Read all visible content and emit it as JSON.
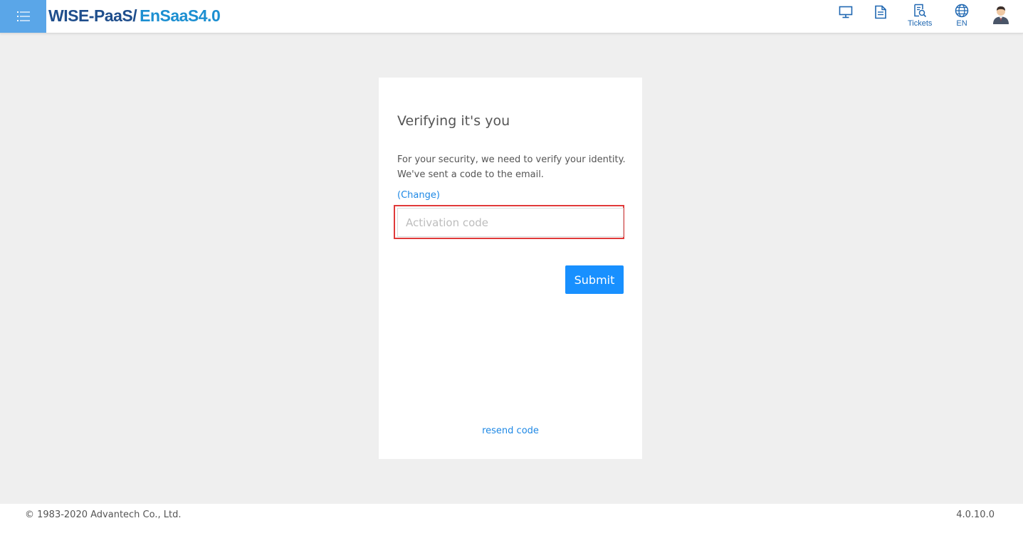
{
  "header": {
    "menu_icon": "list-menu-icon",
    "logo_part1": "WISE-PaaS/",
    "logo_part2": "EnSaaS4.0",
    "icons": [
      {
        "name": "monitor-icon",
        "label": ""
      },
      {
        "name": "document-icon",
        "label": ""
      },
      {
        "name": "tickets-icon",
        "label": "Tickets"
      },
      {
        "name": "globe-icon",
        "label": "EN"
      },
      {
        "name": "user-avatar-icon",
        "label": ""
      }
    ],
    "colors": {
      "menu_bg": "#5aa6e8",
      "icon": "#1f67b1",
      "logo_dark": "#1f4e8c",
      "logo_light": "#1c8fd1"
    }
  },
  "card": {
    "title": "Verifying it's you",
    "desc_line1": "For your security, we need to verify your identity.",
    "desc_line2": "We've sent a code to the email.",
    "change_link": "(Change)",
    "input_placeholder": "Activation code",
    "input_value": "",
    "submit_label": "Submit",
    "resend_link": "resend code",
    "colors": {
      "accent": "#1890ff",
      "highlight": "#e03a3a"
    }
  },
  "footer": {
    "copyright": "© 1983-2020 Advantech Co., Ltd.",
    "version": "4.0.10.0"
  }
}
